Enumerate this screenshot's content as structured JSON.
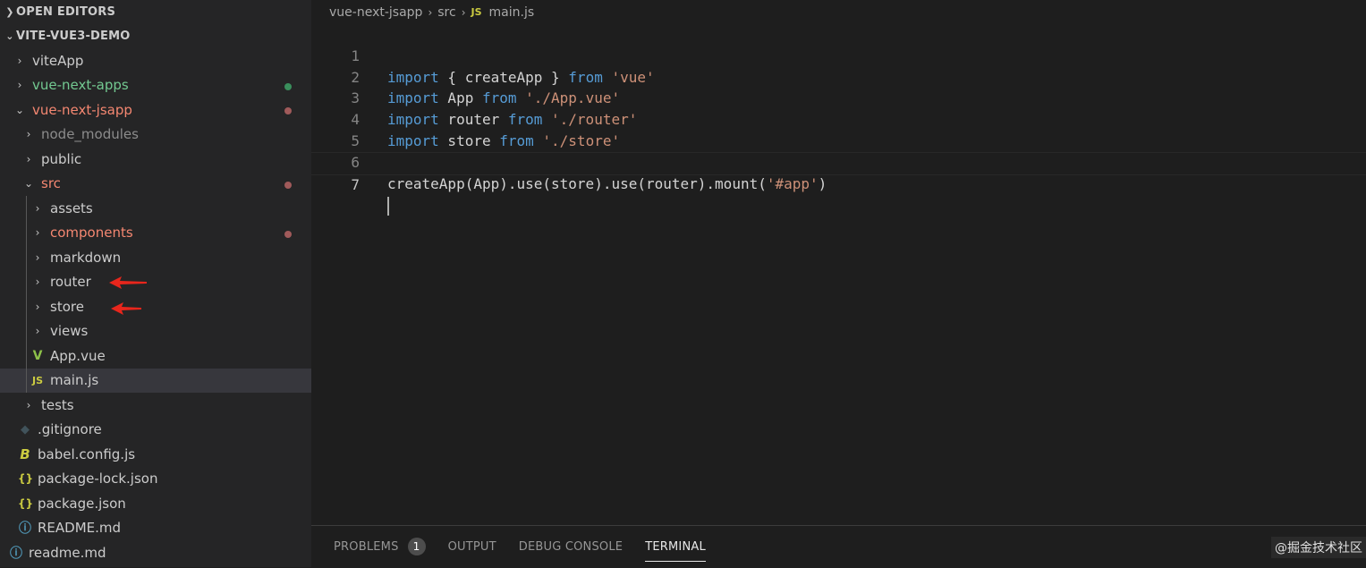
{
  "explorer": {
    "open_editors_label": "OPEN EDITORS",
    "workspace_label": "VITE-VUE3-DEMO",
    "items": [
      {
        "label": "viteApp"
      },
      {
        "label": "vue-next-apps"
      },
      {
        "label": "vue-next-jsapp"
      },
      {
        "label": "node_modules"
      },
      {
        "label": "public"
      },
      {
        "label": "src"
      },
      {
        "label": "assets"
      },
      {
        "label": "components"
      },
      {
        "label": "markdown"
      },
      {
        "label": "router"
      },
      {
        "label": "store"
      },
      {
        "label": "views"
      },
      {
        "label": "App.vue"
      },
      {
        "label": "main.js"
      },
      {
        "label": "tests"
      },
      {
        "label": ".gitignore"
      },
      {
        "label": "babel.config.js"
      },
      {
        "label": "package-lock.json"
      },
      {
        "label": "package.json"
      },
      {
        "label": "README.md"
      },
      {
        "label": "readme.md"
      }
    ]
  },
  "breadcrumb": {
    "folder": "vue-next-jsapp",
    "subfolder": "src",
    "file_icon": "JS",
    "file": "main.js"
  },
  "editor": {
    "line_numbers": [
      "1",
      "2",
      "3",
      "4",
      "5",
      "6",
      "7"
    ],
    "tokens": {
      "l1_kw": "import",
      "l1_mid": " { createApp } ",
      "l1_from": "from",
      "l1_str": " 'vue'",
      "l2_kw": "import",
      "l2_mid": " App ",
      "l2_from": "from",
      "l2_str": " './App.vue'",
      "l3_kw": "import",
      "l3_mid": " router ",
      "l3_from": "from",
      "l3_str": " './router'",
      "l4_kw": "import",
      "l4_mid": " store ",
      "l4_from": "from",
      "l4_str": " './store'",
      "l6_a": "createApp(App).use(store).use(router).mount(",
      "l6_str": "'#app'",
      "l6_b": ")"
    }
  },
  "panel": {
    "tabs": [
      "PROBLEMS",
      "OUTPUT",
      "DEBUG CONSOLE",
      "TERMINAL"
    ],
    "problems_count": "1",
    "watermark": "@掘金技术社区"
  },
  "colors": {
    "git_added": "#73c991",
    "git_modified": "#f48771",
    "modified_dot": "#a05a5a",
    "added_dot": "#3a8f5c",
    "keyword": "#569cd6",
    "string": "#ce9178",
    "arrow": "#e8261c"
  }
}
